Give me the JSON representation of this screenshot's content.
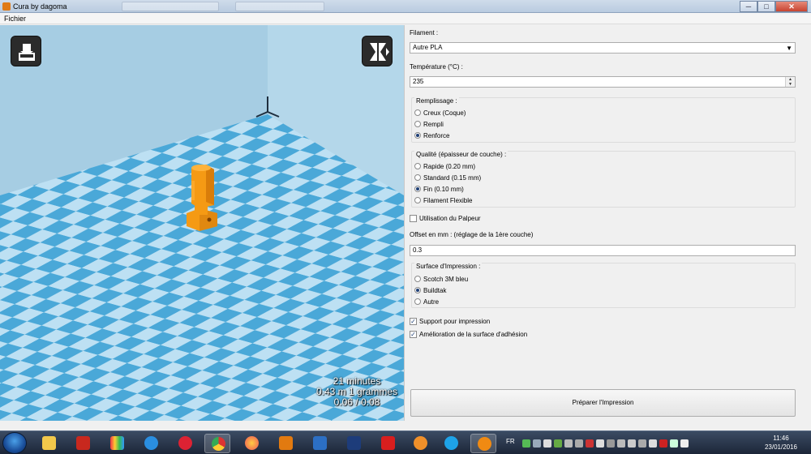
{
  "window": {
    "title": "Cura by dagoma",
    "minimize": "─",
    "maximize": "□",
    "close": "✕"
  },
  "menubar": {
    "file": "Fichier"
  },
  "viewport": {
    "stats": {
      "time": "21 minutes",
      "material": "0.43 m 1 grammes",
      "cost": "0.06 / 0.08"
    },
    "buttons": {
      "load": "load-model-icon",
      "mirror": "mirror-icon"
    },
    "colors": {
      "floor_light": "#bde0f3",
      "floor_dark": "#4aa8d8",
      "wall": "#a8cfe5",
      "model": "#f59a14"
    }
  },
  "panel": {
    "filament": {
      "label": "Filament :",
      "selected": "Autre PLA"
    },
    "temperature": {
      "label": "Température (°C) :",
      "value": "235"
    },
    "infill": {
      "title": "Remplissage :",
      "options": [
        "Creux (Coque)",
        "Rempli",
        "Renforce"
      ],
      "selected_index": 2
    },
    "quality": {
      "title": "Qualité (épaisseur de couche) :",
      "options": [
        "Rapide (0.20 mm)",
        "Standard (0.15 mm)",
        "Fin (0.10 mm)",
        "Filament Flexible"
      ],
      "selected_index": 2
    },
    "probe": {
      "label": "Utilisation du Palpeur",
      "checked": false
    },
    "offset": {
      "label": "Offset en mm : (réglage de la 1ère couche)",
      "value": "0.3"
    },
    "surface": {
      "title": "Surface d'Impression :",
      "options": [
        "Scotch 3M bleu",
        "Buildtak",
        "Autre"
      ],
      "selected_index": 1
    },
    "support": {
      "label": "Support pour impression",
      "checked": true
    },
    "adhesion": {
      "label": "Amélioration de la surface d'adhésion",
      "checked": true
    },
    "prepare_button": "Préparer l'Impression"
  },
  "taskbar": {
    "lang": "FR",
    "time": "11:46",
    "date": "23/01/2016",
    "apps": [
      "file-explorer-icon",
      "filezilla-icon",
      "app-grid-icon",
      "internet-explorer-icon",
      "snipping-tool-icon",
      "chrome-icon",
      "firefox-icon",
      "inventor-icon",
      "fusion-icon",
      "dassault-icon",
      "solidworks-icon",
      "blender-icon",
      "skype-icon",
      "cura-icon"
    ]
  }
}
